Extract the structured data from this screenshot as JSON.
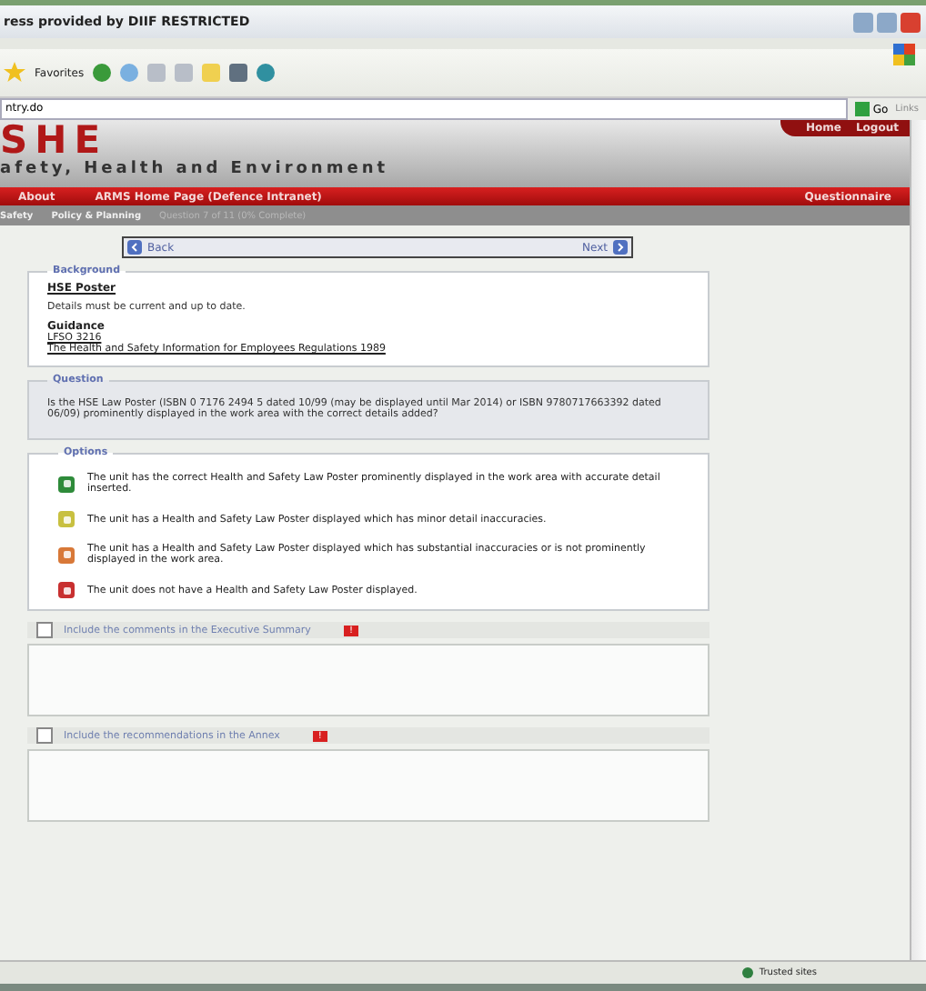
{
  "window": {
    "title": "ress provided by DIIF RESTRICTED"
  },
  "toolbar": {
    "favorites": "Favorites"
  },
  "address_bar": {
    "value": "ntry.do",
    "go": "Go",
    "links": "Links"
  },
  "header": {
    "logo": "SHE",
    "subtitle": "afety, Health and Environment",
    "links": [
      "Home",
      "Logout"
    ]
  },
  "nav": {
    "items": [
      "About",
      "ARMS Home Page (Defence Intranet)"
    ],
    "right": "Questionnaire"
  },
  "breadcrumb": [
    "Safety",
    "Policy & Planning",
    "Question 7 of 11 (0% Complete)"
  ],
  "pager": {
    "back": "Back",
    "next": "Next"
  },
  "background": {
    "legend": "Background",
    "title": "HSE Poster",
    "text": "Details must be current and up to date.",
    "guidance": "Guidance",
    "links": [
      "LFSO 3216",
      "The Health and Safety Information for Employees Regulations 1989"
    ]
  },
  "question": {
    "legend": "Question",
    "text": "Is the HSE Law Poster (ISBN 0 7176 2494 5 dated 10/99 (may be displayed until Mar 2014) or ISBN 9780717663392 dated 06/09) prominently displayed in the work area with the correct details added?"
  },
  "options": {
    "legend": "Options",
    "items": [
      {
        "text": "The unit has the correct Health and Safety Law Poster prominently displayed in the work area with accurate detail inserted.",
        "color": "#2e8b3a"
      },
      {
        "text": "The unit has a Health and Safety Law Poster displayed which has minor detail inaccuracies.",
        "color": "#c8c040"
      },
      {
        "text": "The unit has a Health and Safety Law Poster displayed which has substantial inaccuracies or is not prominently displayed in the work area.",
        "color": "#d87838"
      },
      {
        "text": "The unit does not have a Health and Safety Law Poster displayed.",
        "color": "#c83030"
      }
    ]
  },
  "comments": [
    {
      "label": "Include the  comments in the Executive Summary",
      "checked": false,
      "badge": "!"
    },
    {
      "label": "Include the recommendations in the Annex",
      "checked": false,
      "badge": "!"
    }
  ],
  "status_bar": {
    "zone": "Trusted sites"
  }
}
